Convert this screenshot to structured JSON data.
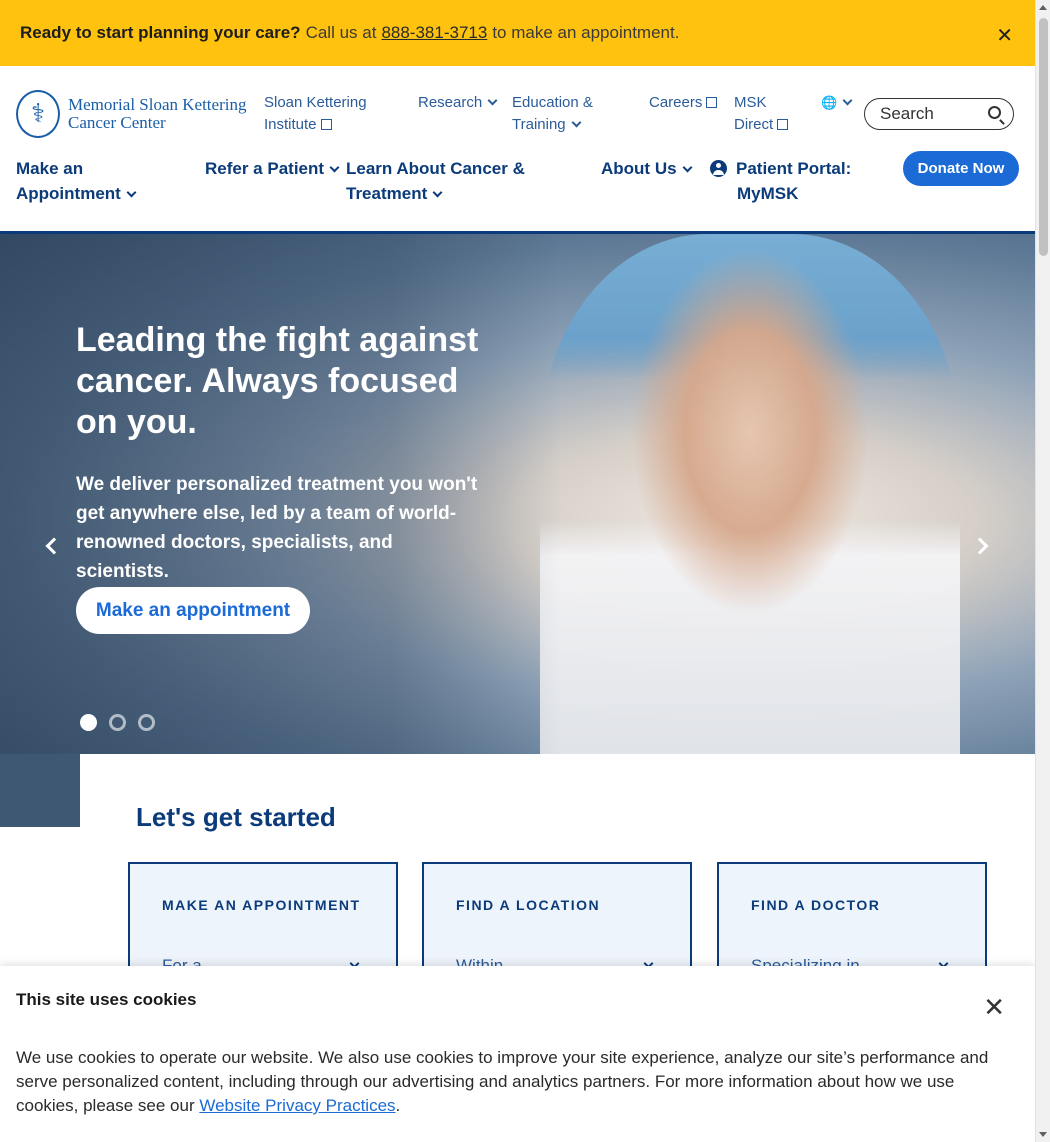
{
  "banner": {
    "lead": "Ready to start planning your care?",
    "pre": "Call us at",
    "phone": "888-381-3713",
    "post": "to make an appointment.",
    "close_glyph": "✕",
    "color": "#ffc20e"
  },
  "logo": {
    "glyph": "⚕",
    "line1": "Memorial Sloan Kettering",
    "line2": "Cancer Center"
  },
  "utility_nav": [
    {
      "line1": "Sloan Kettering",
      "line2": "Institute"
    },
    {
      "line1": "Research"
    },
    {
      "line1": "Education &",
      "line2": "Training"
    },
    {
      "line1": "Careers"
    },
    {
      "line1": "MSK",
      "line2": "Direct"
    }
  ],
  "language": {
    "glyph": "🌐"
  },
  "search": {
    "placeholder": "Search"
  },
  "main_nav": [
    {
      "line1": "Make an",
      "line2": "Appointment"
    },
    {
      "line1": "Refer a Patient"
    },
    {
      "line1": "Learn About Cancer &",
      "line2": "Treatment"
    },
    {
      "line1": "About Us"
    },
    {
      "line1": "Patient Portal:",
      "line2": "MyMSK"
    }
  ],
  "donate": {
    "label": "Donate Now",
    "color": "#1b6ad6"
  },
  "hero": {
    "heading": "Leading the fight against cancer. Always focused on you.",
    "body": "We deliver personalized treatment you won't get anywhere else, led by a team of world-renowned doctors, specialists, and scientists.",
    "cta": "Make an appointment",
    "slides": 3,
    "active_slide": 1
  },
  "get_started": {
    "title": "Let's get started",
    "cards": [
      {
        "label": "MAKE AN APPOINTMENT",
        "select": "For a"
      },
      {
        "label": "FIND A LOCATION",
        "select": "Within"
      },
      {
        "label": "FIND A DOCTOR",
        "select": "Specializing in"
      }
    ]
  },
  "cookie": {
    "title": "This site uses cookies",
    "body_pre": "We use cookies to operate our website. We also use cookies to improve your site experience, analyze our site’s performance and serve personalized content, including through our advertising and analytics partners. For more information about how we use cookies, please see our",
    "link": "Website Privacy Practices",
    "body_post": ".",
    "close_glyph": "✕"
  },
  "colors": {
    "brand_navy": "#0b3b7a",
    "link_blue": "#2b5c9a",
    "accent_blue": "#1b6ad6"
  }
}
